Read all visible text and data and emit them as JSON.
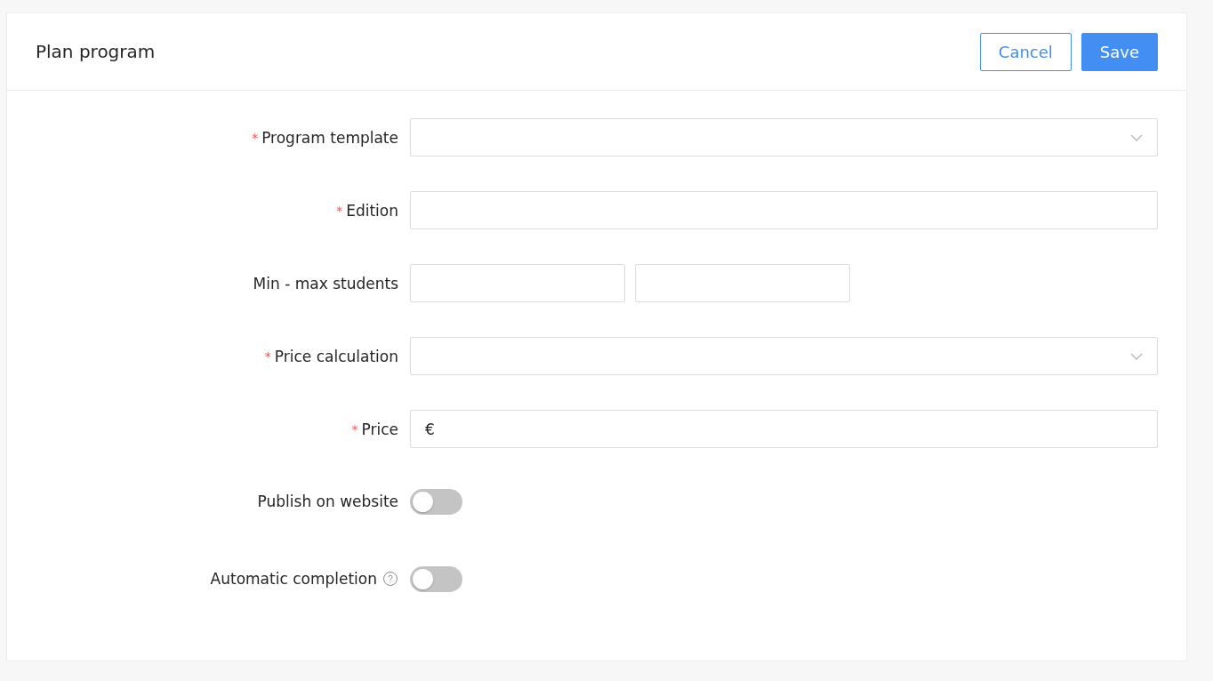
{
  "header": {
    "title": "Plan program",
    "buttons": [
      {
        "label": "Cancel",
        "kind": "secondary"
      },
      {
        "label": "Save",
        "kind": "primary"
      }
    ]
  },
  "required_mark": "*",
  "fields": [
    {
      "label": "Program template",
      "kind": "select",
      "required": true,
      "help": false
    },
    {
      "label": "Edition",
      "kind": "text",
      "required": true,
      "help": false
    },
    {
      "label": "Min - max students",
      "kind": "range",
      "required": false,
      "help": false
    },
    {
      "label": "Price calculation",
      "kind": "select",
      "required": true,
      "help": false
    },
    {
      "label": "Price",
      "kind": "prefixed",
      "prefix": "€",
      "required": true,
      "help": false
    },
    {
      "label": "Publish on website",
      "kind": "switch",
      "on": false,
      "required": false,
      "help": false
    },
    {
      "label": "Automatic completion",
      "kind": "switch",
      "on": false,
      "required": false,
      "help": true
    }
  ]
}
